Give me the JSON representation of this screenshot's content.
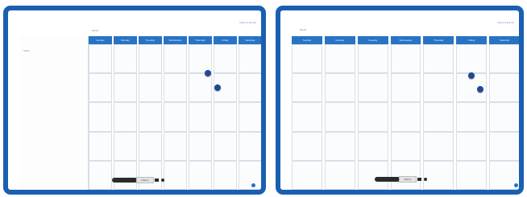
{
  "colors": {
    "frame": "#1a5fb0",
    "header": "#2873c4",
    "magnet": "#214a92",
    "grid_line": "#d8dfe9"
  },
  "boards": [
    {
      "month_label": "Month",
      "top_right_text": "Notes & Events",
      "notes_label": "Notes",
      "weekdays": [
        "Sunday",
        "Monday",
        "Tuesday",
        "Wednesday",
        "Thursday",
        "Friday",
        "Saturday"
      ],
      "marker_label": "Marker"
    },
    {
      "month_label": "Month",
      "top_right_text": "Notes & Events",
      "weekdays": [
        "Sunday",
        "Monday",
        "Tuesday",
        "Wednesday",
        "Thursday",
        "Friday",
        "Saturday"
      ],
      "marker_label": "Marker"
    }
  ],
  "icons": [
    "magnet-icon",
    "marker-icon",
    "eraser-dot-icon"
  ]
}
